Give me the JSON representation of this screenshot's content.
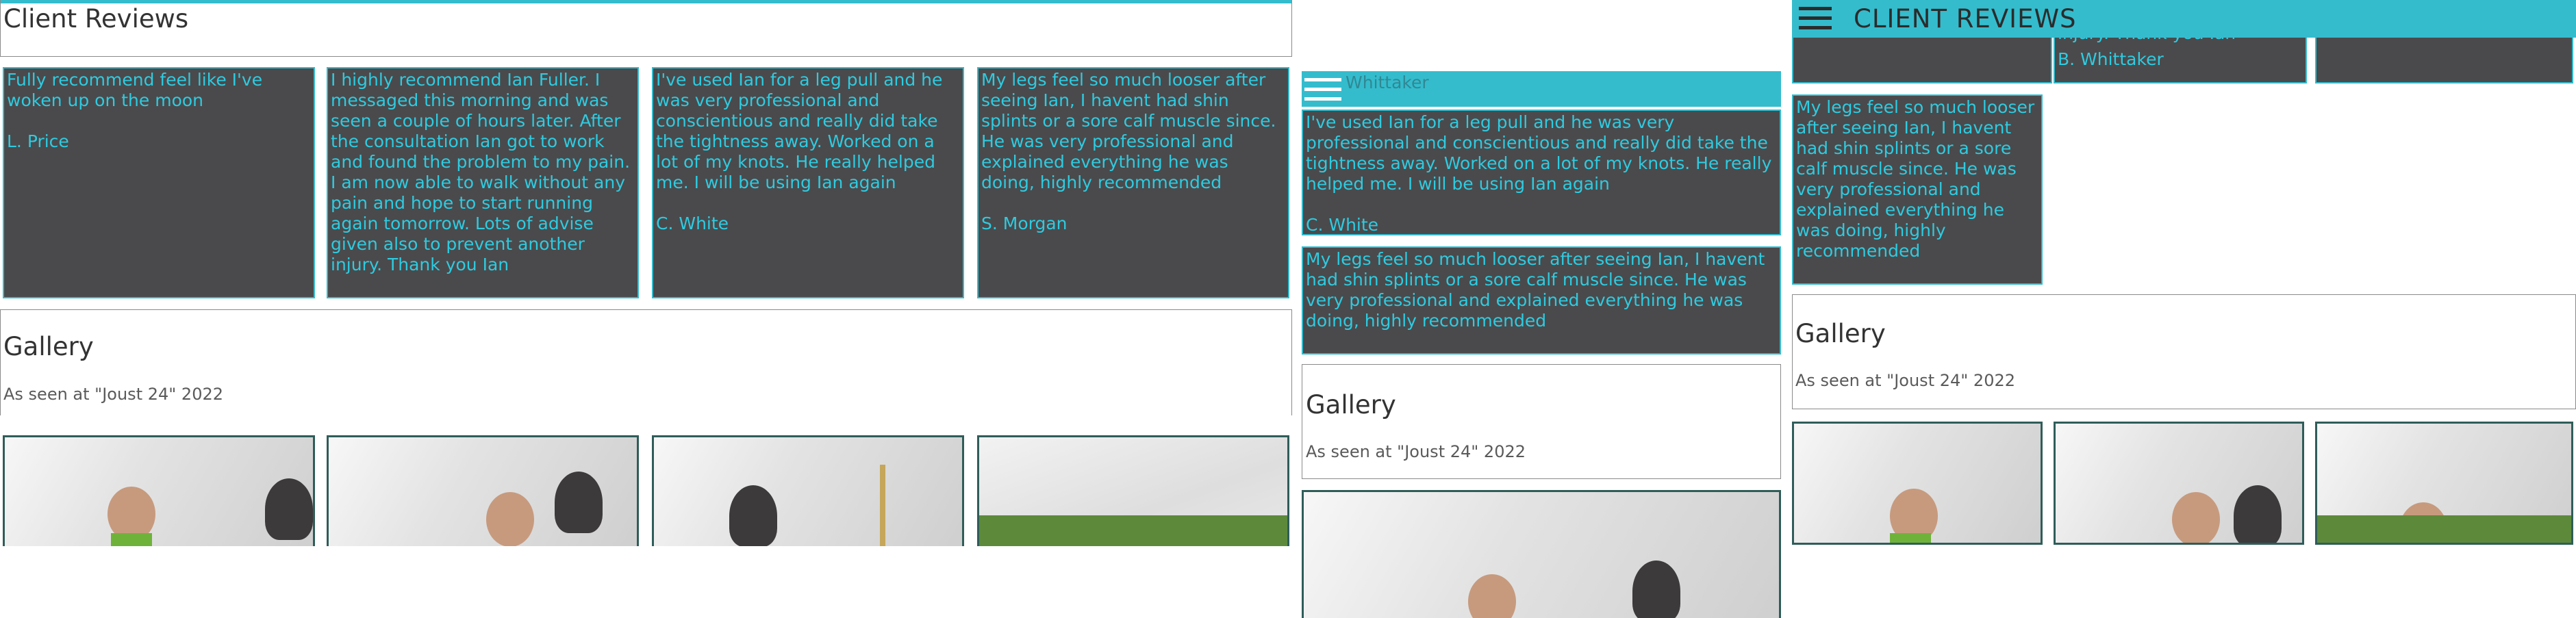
{
  "reviews": {
    "title": "Client Reviews",
    "mobile_title": "CLIENT REVIEWS",
    "items": [
      {
        "text": "Fully recommend feel like I've woken up on the moon",
        "author": "L. Price"
      },
      {
        "text": "I highly recommend Ian Fuller. I messaged this morning and was seen a couple of hours later. After the consultation Ian got to work and found the problem to my pain. I am now able to walk without any pain and hope to start running again tomorrow. Lots of advise given also to prevent another injury. Thank you Ian",
        "author": "B. Whittaker"
      },
      {
        "text": "I've used Ian for a leg pull and he was very professional and conscientious and really did take the tightness away. Worked on a lot of my knots. He really helped me. I will be using Ian again",
        "author": "C. White"
      },
      {
        "text": "My legs feel so much looser after seeing Ian, I havent had shin splints or a sore calf muscle since. He was very professional and explained everything he was doing, highly recommended",
        "author": "S. Morgan"
      }
    ],
    "partial_fragment": "also to prevent another injury. Thank you Ian",
    "partial_author_behind_header": "Whittaker"
  },
  "gallery": {
    "title": "Gallery",
    "subtitle": "As seen at \"Joust 24\" 2022",
    "photos": [
      {
        "icon": "photo-man-green-shirt"
      },
      {
        "icon": "photo-woman-dark-hair"
      },
      {
        "icon": "photo-tent-with-pole"
      },
      {
        "icon": "photo-tent-field"
      }
    ]
  },
  "icons": {
    "menu": "hamburger-menu-icon"
  },
  "colors": {
    "accent": "#34bccd",
    "card_bg": "#4a4a4c",
    "card_text": "#2ecbe0",
    "photo_border": "#2f5d59"
  }
}
